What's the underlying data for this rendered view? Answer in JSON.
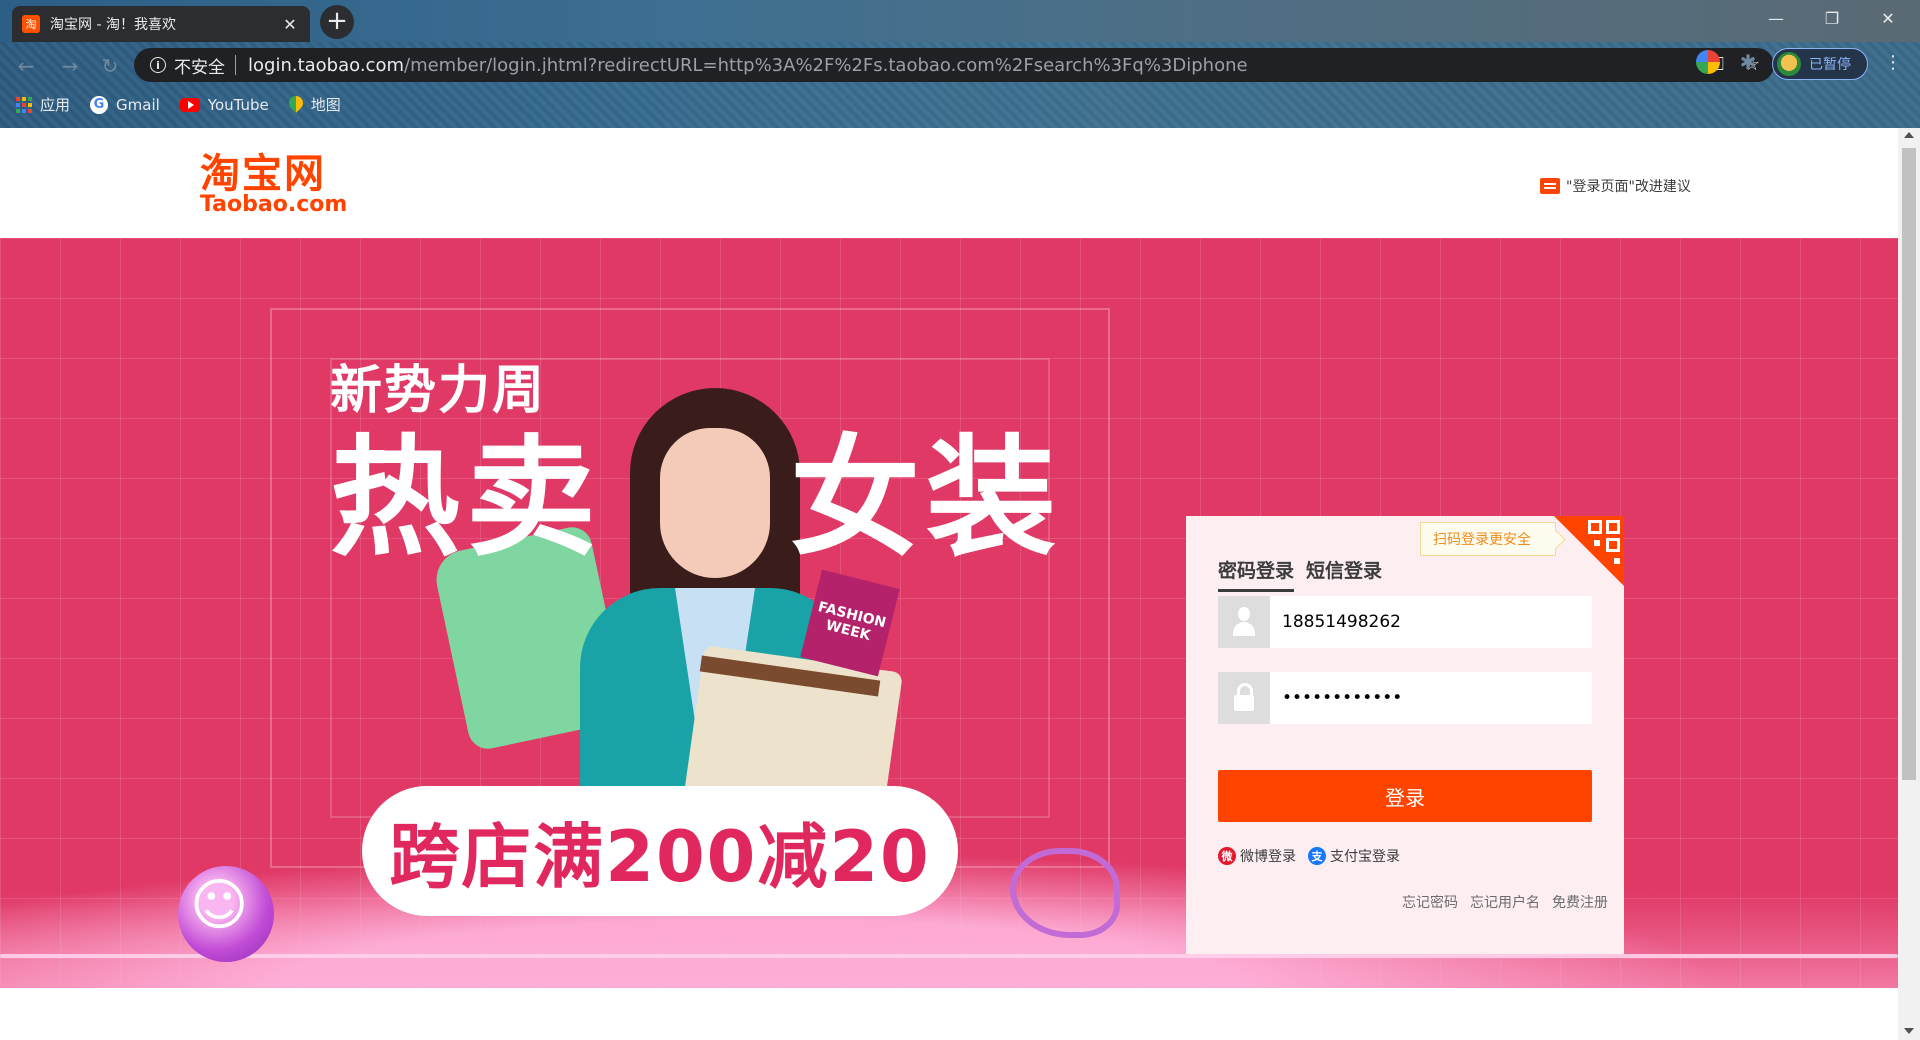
{
  "browser": {
    "tab_title": "淘宝网 - 淘！我喜欢",
    "tab_favicon": "淘",
    "new_tab": "+",
    "window_controls": {
      "minimize": "—",
      "restore": "❐",
      "close": "✕"
    },
    "nav": {
      "back": "←",
      "forward": "→",
      "reload": "↻"
    },
    "omnibox": {
      "security_label": "不安全",
      "host": "login.taobao.com",
      "path": "/member/login.jhtml?redirectURL=http%3A%2F%2Fs.taobao.com%2Fsearch%3Fq%3Diphone"
    },
    "profile_label": "已暂停",
    "menu": "⋮",
    "bookmarks": [
      {
        "label": "应用",
        "icon": "apps-grid-icon"
      },
      {
        "label": "Gmail",
        "icon": "google-icon"
      },
      {
        "label": "YouTube",
        "icon": "youtube-icon"
      },
      {
        "label": "地图",
        "icon": "maps-icon"
      }
    ]
  },
  "header": {
    "logo_cn": "淘宝网",
    "logo_en": "Taobao.com",
    "feedback": "\"登录页面\"改进建议"
  },
  "banner": {
    "subtitle": "新势力周",
    "headline_left": "热卖",
    "headline_right": "女装",
    "tag_text": "FASHION WEEK",
    "promo": "跨店满200减20"
  },
  "login": {
    "qr_hint": "扫码登录更安全",
    "tabs": [
      {
        "label": "密码登录",
        "active": true
      },
      {
        "label": "短信登录",
        "active": false
      }
    ],
    "username_value": "18851498262",
    "password_value": "••••••••••••",
    "submit_label": "登录",
    "social": [
      {
        "label": "微博登录",
        "icon": "weibo-icon"
      },
      {
        "label": "支付宝登录",
        "icon": "alipay-icon"
      }
    ],
    "links": [
      "忘记密码",
      "忘记用户名",
      "免费注册"
    ]
  },
  "colors": {
    "brand": "#ff4400",
    "banner_bg": "#e03966",
    "login_bg": "#fdeef2"
  }
}
